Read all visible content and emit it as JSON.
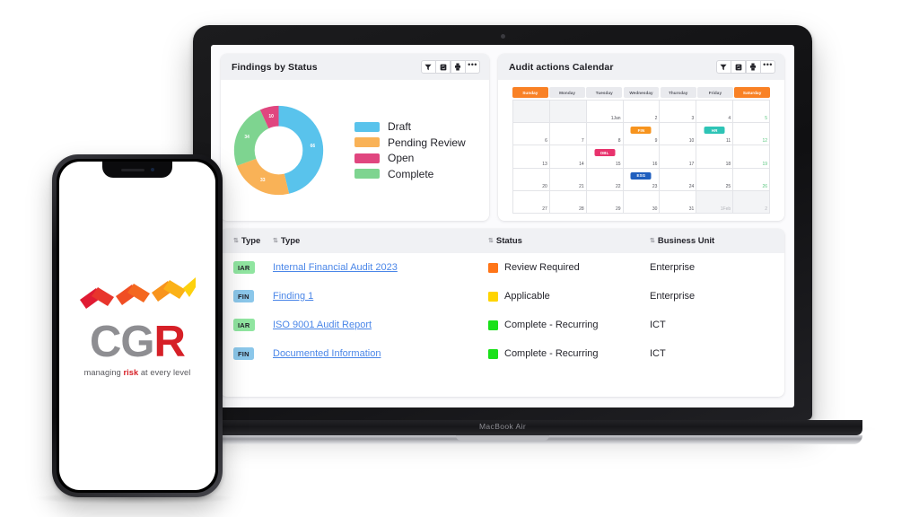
{
  "device": {
    "laptop_label": "MacBook Air"
  },
  "panels": {
    "donut": {
      "title": "Findings by Status",
      "tools": [
        "filter-icon",
        "refresh-icon",
        "export-icon",
        "more-icon"
      ]
    },
    "calendar": {
      "title": "Audit actions Calendar",
      "tools": [
        "filter-icon",
        "refresh-icon",
        "export-icon",
        "more-icon"
      ],
      "dow": [
        "Sunday",
        "Monday",
        "Tuesday",
        "Wednesday",
        "Thursday",
        "Friday",
        "Saturday"
      ],
      "weekend_color": "#f98125",
      "days": [
        {
          "n": "",
          "other": true
        },
        {
          "n": "",
          "other": true
        },
        {
          "n": "1Jan"
        },
        {
          "n": "2"
        },
        {
          "n": "3"
        },
        {
          "n": "4"
        },
        {
          "n": "5",
          "wknd": true
        },
        {
          "n": "6"
        },
        {
          "n": "7"
        },
        {
          "n": "8"
        },
        {
          "n": "9",
          "ev": "FIN",
          "ev_color": "#f7941e"
        },
        {
          "n": "10"
        },
        {
          "n": "11",
          "ev": "HR",
          "ev_color": "#2ec4b6"
        },
        {
          "n": "12",
          "wknd": true
        },
        {
          "n": "13"
        },
        {
          "n": "14"
        },
        {
          "n": "15",
          "ev": "OBL",
          "ev_color": "#e8336d"
        },
        {
          "n": "16"
        },
        {
          "n": "17"
        },
        {
          "n": "18"
        },
        {
          "n": "19",
          "wknd": true
        },
        {
          "n": "20"
        },
        {
          "n": "21"
        },
        {
          "n": "22"
        },
        {
          "n": "23",
          "ev": "ESG",
          "ev_color": "#1f5fbf"
        },
        {
          "n": "24"
        },
        {
          "n": "25"
        },
        {
          "n": "26",
          "wknd": true
        },
        {
          "n": "27"
        },
        {
          "n": "28"
        },
        {
          "n": "29"
        },
        {
          "n": "30"
        },
        {
          "n": "31"
        },
        {
          "n": "1Feb",
          "other": true
        },
        {
          "n": "2",
          "other": true
        }
      ]
    }
  },
  "chart_data": {
    "type": "pie",
    "title": "Findings by Status",
    "labels": [
      "Draft",
      "Pending Review",
      "Complete",
      "Open"
    ],
    "values": [
      66,
      33,
      34,
      10
    ],
    "colors": [
      "#59c3ec",
      "#f9b257",
      "#7ed490",
      "#e0467f"
    ],
    "legend_position": "right",
    "donut": true
  },
  "table": {
    "columns": [
      {
        "label": "Type",
        "sort": "sort-icon"
      },
      {
        "label": "Type",
        "sort": "sort-icon"
      },
      {
        "label": "Status",
        "sort": "sort-icon"
      },
      {
        "label": "Business Unit",
        "sort": "sort-icon"
      }
    ],
    "rows": [
      {
        "type": "IAR",
        "type_color": "#90e5a0",
        "name": "Internal Financial Audit 2023",
        "status": "Review Required",
        "status_color": "#ff7518",
        "bu": "Enterprise"
      },
      {
        "type": "FIN",
        "type_color": "#8bc7ea",
        "name": "Finding 1",
        "status": "Applicable",
        "status_color": "#ffd400",
        "bu": "Enterprise"
      },
      {
        "type": "IAR",
        "type_color": "#90e5a0",
        "name": "ISO 9001 Audit Report",
        "status": "Complete - Recurring",
        "status_color": "#1ae11a",
        "bu": "ICT"
      },
      {
        "type": "FIN",
        "type_color": "#8bc7ea",
        "name": "Documented Information",
        "status": "Complete - Recurring",
        "status_color": "#1ae11a",
        "bu": "ICT"
      }
    ]
  },
  "phone_app": {
    "logo_word_1": "CG",
    "logo_word_2": "R",
    "tagline_pre": "managing ",
    "tagline_accent": "risk",
    "tagline_post": " at every level",
    "accent_color": "#d62027"
  }
}
